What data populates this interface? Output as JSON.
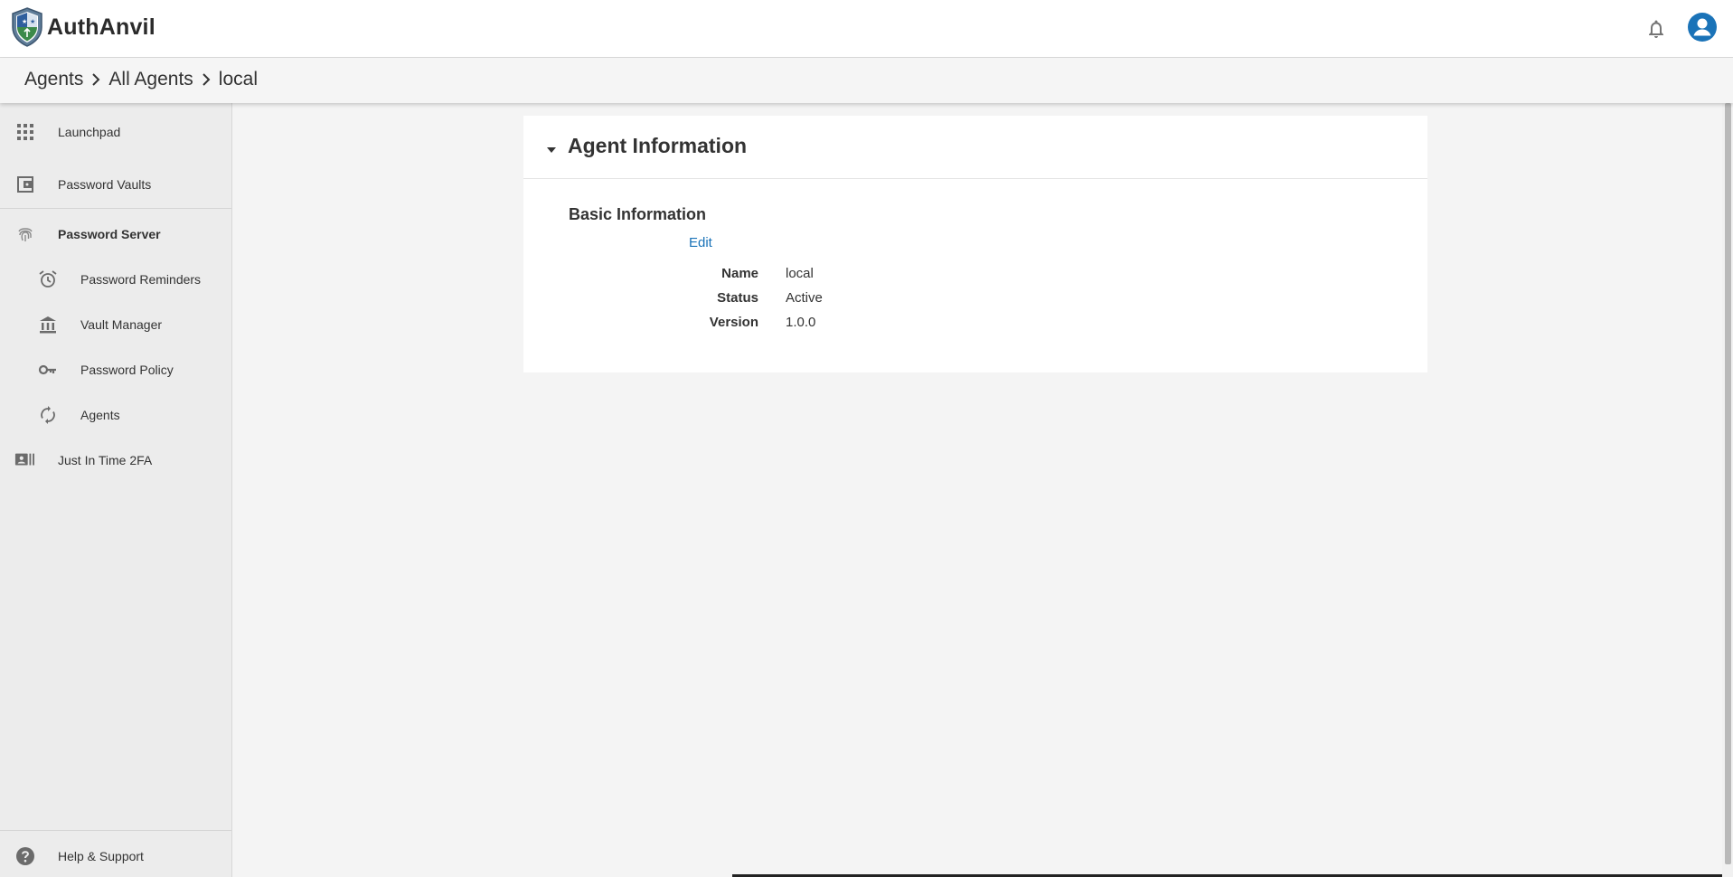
{
  "app": {
    "name": "AuthAnvil"
  },
  "header": {
    "notifications_icon": "bell-icon",
    "account_icon": "account-circle-icon"
  },
  "breadcrumb": {
    "items": [
      "Agents",
      "All Agents",
      "local"
    ]
  },
  "sidebar": {
    "items": [
      {
        "label": "Launchpad",
        "icon": "grid-icon"
      },
      {
        "label": "Password Vaults",
        "icon": "wallet-icon"
      },
      {
        "label": "Password Server",
        "icon": "fingerprint-icon"
      },
      {
        "label": "Password Reminders",
        "icon": "alarm-clock-icon"
      },
      {
        "label": "Vault Manager",
        "icon": "bank-icon"
      },
      {
        "label": "Password Policy",
        "icon": "key-icon"
      },
      {
        "label": "Agents",
        "icon": "sync-icon"
      },
      {
        "label": "Just In Time 2FA",
        "icon": "contact-card-icon"
      }
    ],
    "footer": {
      "label": "Help & Support",
      "icon": "help-circle-icon"
    }
  },
  "card": {
    "title": "Agent Information",
    "section": "Basic Information",
    "edit_label": "Edit",
    "fields": [
      {
        "key": "Name",
        "value": "local"
      },
      {
        "key": "Status",
        "value": "Active"
      },
      {
        "key": "Version",
        "value": "1.0.0"
      }
    ]
  },
  "colors": {
    "accent": "#1a73b8",
    "sidebar_bg": "#ececec",
    "page_bg": "#f4f4f4"
  }
}
